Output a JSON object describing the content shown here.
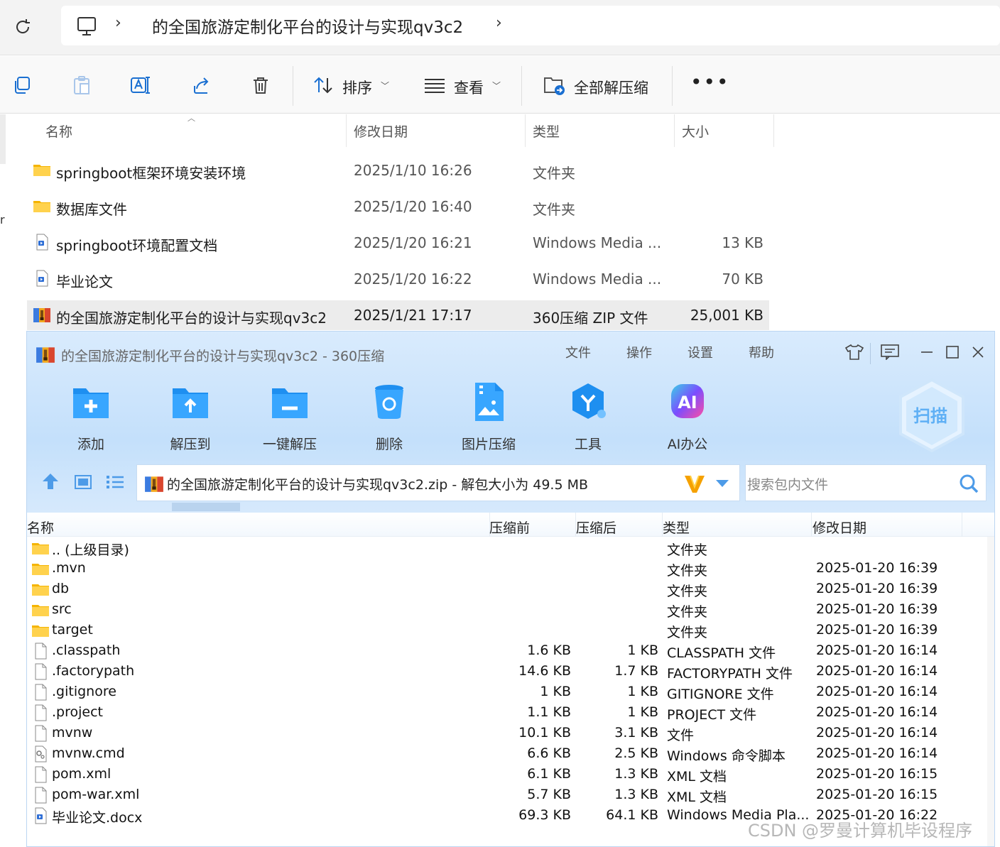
{
  "explorer": {
    "address_path": "的全国旅游定制化平台的设计与实现qv3c2",
    "toolbar": {
      "sort_label": "排序",
      "view_label": "查看",
      "extract_all_label": "全部解压缩",
      "more_label": "•••"
    },
    "columns": {
      "name": "名称",
      "date": "修改日期",
      "type": "类型",
      "size": "大小"
    },
    "left_fragment": "r",
    "rows": [
      {
        "name": "springboot框架环境安装环境",
        "date": "2025/1/10 16:26",
        "type": "文件夹",
        "size": "",
        "icon": "folder-icon"
      },
      {
        "name": "数据库文件",
        "date": "2025/1/20 16:40",
        "type": "文件夹",
        "size": "",
        "icon": "folder-icon"
      },
      {
        "name": "springboot环境配置文档",
        "date": "2025/1/20 16:21",
        "type": "Windows Media ...",
        "size": "13 KB",
        "icon": "media-file-icon"
      },
      {
        "name": "毕业论文",
        "date": "2025/1/20 16:22",
        "type": "Windows Media ...",
        "size": "70 KB",
        "icon": "media-file-icon"
      },
      {
        "name": "的全国旅游定制化平台的设计与实现qv3c2",
        "date": "2025/1/21 17:17",
        "type": "360压缩 ZIP 文件",
        "size": "25,001 KB",
        "icon": "zip-archive-icon"
      }
    ]
  },
  "zip": {
    "title": "的全国旅游定制化平台的设计与实现qv3c2 - 360压缩",
    "menu": {
      "file": "文件",
      "operate": "操作",
      "settings": "设置",
      "help": "帮助"
    },
    "tools": {
      "add": "添加",
      "extract_to": "解压到",
      "one_click": "一键解压",
      "delete": "删除",
      "image_compress": "图片压缩",
      "tools": "工具",
      "ai_office": "AI办公",
      "ai_badge": "AI",
      "scan": "扫描"
    },
    "path_text": "的全国旅游定制化平台的设计与实现qv3c2.zip - 解包大小为 49.5 MB",
    "search_placeholder": "搜索包内文件",
    "columns": {
      "name": "名称",
      "before": "压缩前",
      "after": "压缩后",
      "type": "类型",
      "date": "修改日期"
    },
    "rows": [
      {
        "name": ".. (上级目录)",
        "before": "",
        "after": "",
        "type": "文件夹",
        "date": "",
        "icon": "folder-icon"
      },
      {
        "name": ".mvn",
        "before": "",
        "after": "",
        "type": "文件夹",
        "date": "2025-01-20 16:39",
        "icon": "folder-icon"
      },
      {
        "name": "db",
        "before": "",
        "after": "",
        "type": "文件夹",
        "date": "2025-01-20 16:39",
        "icon": "folder-icon"
      },
      {
        "name": "src",
        "before": "",
        "after": "",
        "type": "文件夹",
        "date": "2025-01-20 16:39",
        "icon": "folder-icon"
      },
      {
        "name": "target",
        "before": "",
        "after": "",
        "type": "文件夹",
        "date": "2025-01-20 16:39",
        "icon": "folder-icon"
      },
      {
        "name": ".classpath",
        "before": "1.6 KB",
        "after": "1 KB",
        "type": "CLASSPATH 文件",
        "date": "2025-01-20 16:14",
        "icon": "blank-file-icon"
      },
      {
        "name": ".factorypath",
        "before": "14.6 KB",
        "after": "1.7 KB",
        "type": "FACTORYPATH 文件",
        "date": "2025-01-20 16:14",
        "icon": "blank-file-icon"
      },
      {
        "name": ".gitignore",
        "before": "1 KB",
        "after": "1 KB",
        "type": "GITIGNORE 文件",
        "date": "2025-01-20 16:14",
        "icon": "blank-file-icon"
      },
      {
        "name": ".project",
        "before": "1.1 KB",
        "after": "1 KB",
        "type": "PROJECT 文件",
        "date": "2025-01-20 16:14",
        "icon": "blank-file-icon"
      },
      {
        "name": "mvnw",
        "before": "10.1 KB",
        "after": "3.1 KB",
        "type": "文件",
        "date": "2025-01-20 16:14",
        "icon": "blank-file-icon"
      },
      {
        "name": "mvnw.cmd",
        "before": "6.6 KB",
        "after": "2.5 KB",
        "type": "Windows 命令脚本",
        "date": "2025-01-20 16:14",
        "icon": "cmd-script-icon"
      },
      {
        "name": "pom.xml",
        "before": "6.1 KB",
        "after": "1.3 KB",
        "type": "XML 文档",
        "date": "2025-01-20 16:15",
        "icon": "blank-file-icon"
      },
      {
        "name": "pom-war.xml",
        "before": "5.7 KB",
        "after": "1.3 KB",
        "type": "XML 文档",
        "date": "2025-01-20 16:15",
        "icon": "blank-file-icon"
      },
      {
        "name": "毕业论文.docx",
        "before": "69.3 KB",
        "after": "64.1 KB",
        "type": "Windows Media Pla...",
        "date": "2025-01-20 16:22",
        "icon": "media-file-icon"
      }
    ]
  },
  "watermark": "CSDN @罗曼计算机毕设程序",
  "colors": {
    "zip_header_blue": "#c4e0fb",
    "tool_blue": "#1e8ff0",
    "folder_yellow": "#f7c948",
    "ai_purple": "#7b4dff"
  }
}
